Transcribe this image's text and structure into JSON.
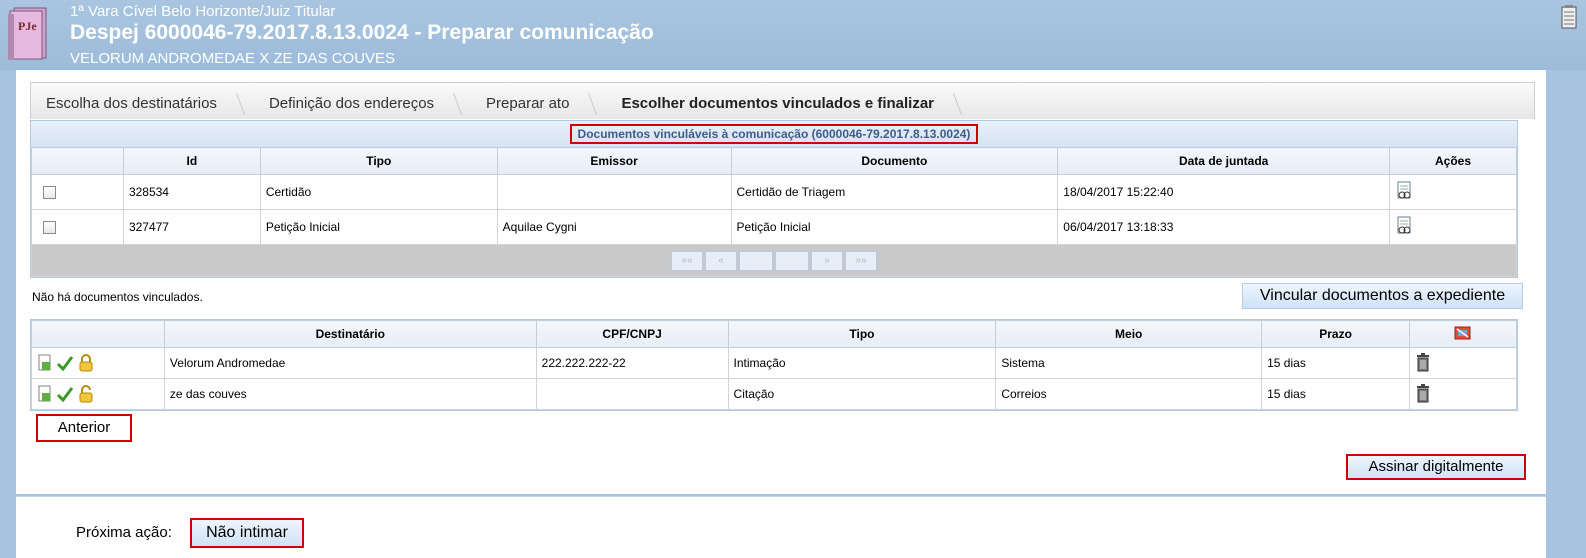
{
  "header": {
    "court": "1ª Vara Cível Belo Horizonte/Juiz Titular",
    "title": "Despej 6000046-79.2017.8.13.0024 - Preparar comunicação",
    "parties": "VELORUM ANDROMEDAE X ZE DAS COUVES",
    "logo_icon": "pje-logo-icon",
    "notes_icon": "notepad-icon"
  },
  "tabs": [
    {
      "label": "Escolha dos destinatários",
      "active": false
    },
    {
      "label": "Definição dos endereços",
      "active": false
    },
    {
      "label": "Preparar ato",
      "active": false
    },
    {
      "label": "Escolher documentos vinculados e finalizar",
      "active": true
    }
  ],
  "docs_table": {
    "caption": "Documentos vinculáveis à comunicação (6000046-79.2017.8.13.0024)",
    "headers": [
      "",
      "Id",
      "Tipo",
      "Emissor",
      "Documento",
      "Data de juntada",
      "Ações"
    ],
    "rows": [
      {
        "id": "328534",
        "tipo": "Certidão",
        "emissor": "",
        "documento": "Certidão de Triagem",
        "data": "18/04/2017 15:22:40"
      },
      {
        "id": "327477",
        "tipo": "Petição Inicial",
        "emissor": "Aquilae Cygni",
        "documento": "Petição Inicial",
        "data": "06/04/2017 13:18:33"
      }
    ],
    "pager": [
      "««",
      "«",
      "",
      "",
      "»",
      "»»"
    ]
  },
  "no_docs_text": "Não há documentos vinculados.",
  "link_button": "Vincular documentos a expediente",
  "dest_table": {
    "headers": [
      "",
      "Destinatário",
      "CPF/CNPJ",
      "Tipo",
      "Meio",
      "Prazo",
      ""
    ],
    "rows": [
      {
        "destinatario": "Velorum Andromedae",
        "cpf": "222.222.222-22",
        "tipo": "Intimação",
        "meio": "Sistema",
        "prazo": "15 dias"
      },
      {
        "destinatario": "ze das couves",
        "cpf": "",
        "tipo": "Citação",
        "meio": "Correios",
        "prazo": "15 dias"
      }
    ]
  },
  "buttons": {
    "anterior": "Anterior",
    "assinar": "Assinar digitalmente",
    "next_label": "Próxima ação:",
    "nao_intimar": "Não intimar"
  },
  "colors": {
    "header_bg": "#a7c3df",
    "highlight": "#d00000",
    "caption_text": "#3e5d86"
  }
}
